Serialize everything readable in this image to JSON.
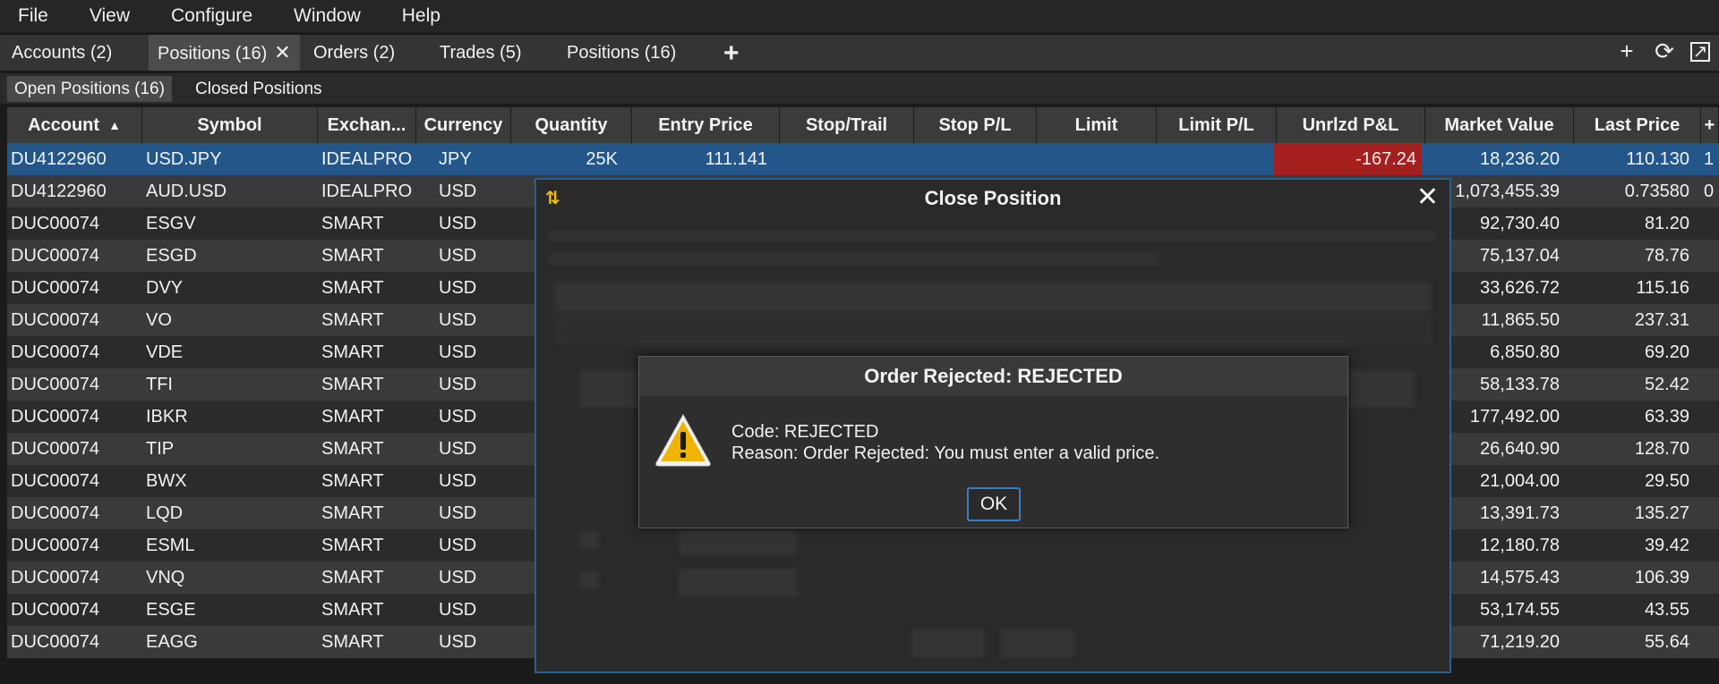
{
  "menu": [
    "File",
    "View",
    "Configure",
    "Window",
    "Help"
  ],
  "tabs": [
    {
      "label": "Accounts (2)"
    },
    {
      "label": "Positions (16)",
      "close": "✕"
    },
    {
      "label": "Orders (2)"
    },
    {
      "label": "Trades (5)"
    },
    {
      "label": "Positions (16)"
    }
  ],
  "subtabs": [
    "Open Positions (16)",
    "Closed Positions"
  ],
  "columns": {
    "account": "Account",
    "symbol": "Symbol",
    "exchange": "Exchan...",
    "currency": "Currency",
    "quantity": "Quantity",
    "entry": "Entry Price",
    "stoptrail": "Stop/Trail",
    "stoppl": "Stop P/L",
    "limit": "Limit",
    "limitpl": "Limit P/L",
    "unrlzd": "Unrlzd P&L",
    "mktval": "Market Value",
    "last": "Last Price",
    "more": "+"
  },
  "rows": [
    {
      "account": "DU4122960",
      "symbol": "USD.JPY",
      "exchange": "IDEALPRO",
      "currency": "JPY",
      "quantity": "25K",
      "entry": "111.141",
      "unrlzd": "-167.24",
      "mktval": "18,236.20",
      "last": "110.130",
      "edge": "1"
    },
    {
      "account": "DU4122960",
      "symbol": "AUD.USD",
      "exchange": "IDEALPRO",
      "currency": "USD",
      "quantity": "",
      "entry": "",
      "unrlzd": "",
      "mktval": "1,073,455.39",
      "last": "0.73580",
      "edge": "0"
    },
    {
      "account": "DUC00074",
      "symbol": "ESGV",
      "exchange": "SMART",
      "currency": "USD",
      "mktval": "92,730.40",
      "last": "81.20"
    },
    {
      "account": "DUC00074",
      "symbol": "ESGD",
      "exchange": "SMART",
      "currency": "USD",
      "mktval": "75,137.04",
      "last": "78.76"
    },
    {
      "account": "DUC00074",
      "symbol": "DVY",
      "exchange": "SMART",
      "currency": "USD",
      "mktval": "33,626.72",
      "last": "115.16"
    },
    {
      "account": "DUC00074",
      "symbol": "VO",
      "exchange": "SMART",
      "currency": "USD",
      "mktval": "11,865.50",
      "last": "237.31"
    },
    {
      "account": "DUC00074",
      "symbol": "VDE",
      "exchange": "SMART",
      "currency": "USD",
      "mktval": "6,850.80",
      "last": "69.20"
    },
    {
      "account": "DUC00074",
      "symbol": "TFI",
      "exchange": "SMART",
      "currency": "USD",
      "mktval": "58,133.78",
      "last": "52.42"
    },
    {
      "account": "DUC00074",
      "symbol": "IBKR",
      "exchange": "SMART",
      "currency": "USD",
      "mktval": "177,492.00",
      "last": "63.39"
    },
    {
      "account": "DUC00074",
      "symbol": "TIP",
      "exchange": "SMART",
      "currency": "USD",
      "mktval": "26,640.90",
      "last": "128.70"
    },
    {
      "account": "DUC00074",
      "symbol": "BWX",
      "exchange": "SMART",
      "currency": "USD",
      "mktval": "21,004.00",
      "last": "29.50"
    },
    {
      "account": "DUC00074",
      "symbol": "LQD",
      "exchange": "SMART",
      "currency": "USD",
      "mktval": "13,391.73",
      "last": "135.27"
    },
    {
      "account": "DUC00074",
      "symbol": "ESML",
      "exchange": "SMART",
      "currency": "USD",
      "mktval": "12,180.78",
      "last": "39.42"
    },
    {
      "account": "DUC00074",
      "symbol": "VNQ",
      "exchange": "SMART",
      "currency": "USD",
      "mktval": "14,575.43",
      "last": "106.39"
    },
    {
      "account": "DUC00074",
      "symbol": "ESGE",
      "exchange": "SMART",
      "currency": "USD",
      "mktval": "53,174.55",
      "last": "43.55"
    },
    {
      "account": "DUC00074",
      "symbol": "EAGG",
      "exchange": "SMART",
      "currency": "USD",
      "mktval": "71,219.20",
      "last": "55.64"
    }
  ],
  "close_dialog": {
    "title": "Close Position",
    "close": "✕"
  },
  "alert": {
    "title": "Order Rejected: REJECTED",
    "code": "Code: REJECTED",
    "reason": "Reason: Order Rejected: You must enter a valid price.",
    "ok": "OK"
  },
  "colors": {
    "selected_row": "#23578a",
    "loss": "#a61f1f",
    "dialog_border": "#2e5e8e",
    "warning": "#f0b400"
  }
}
